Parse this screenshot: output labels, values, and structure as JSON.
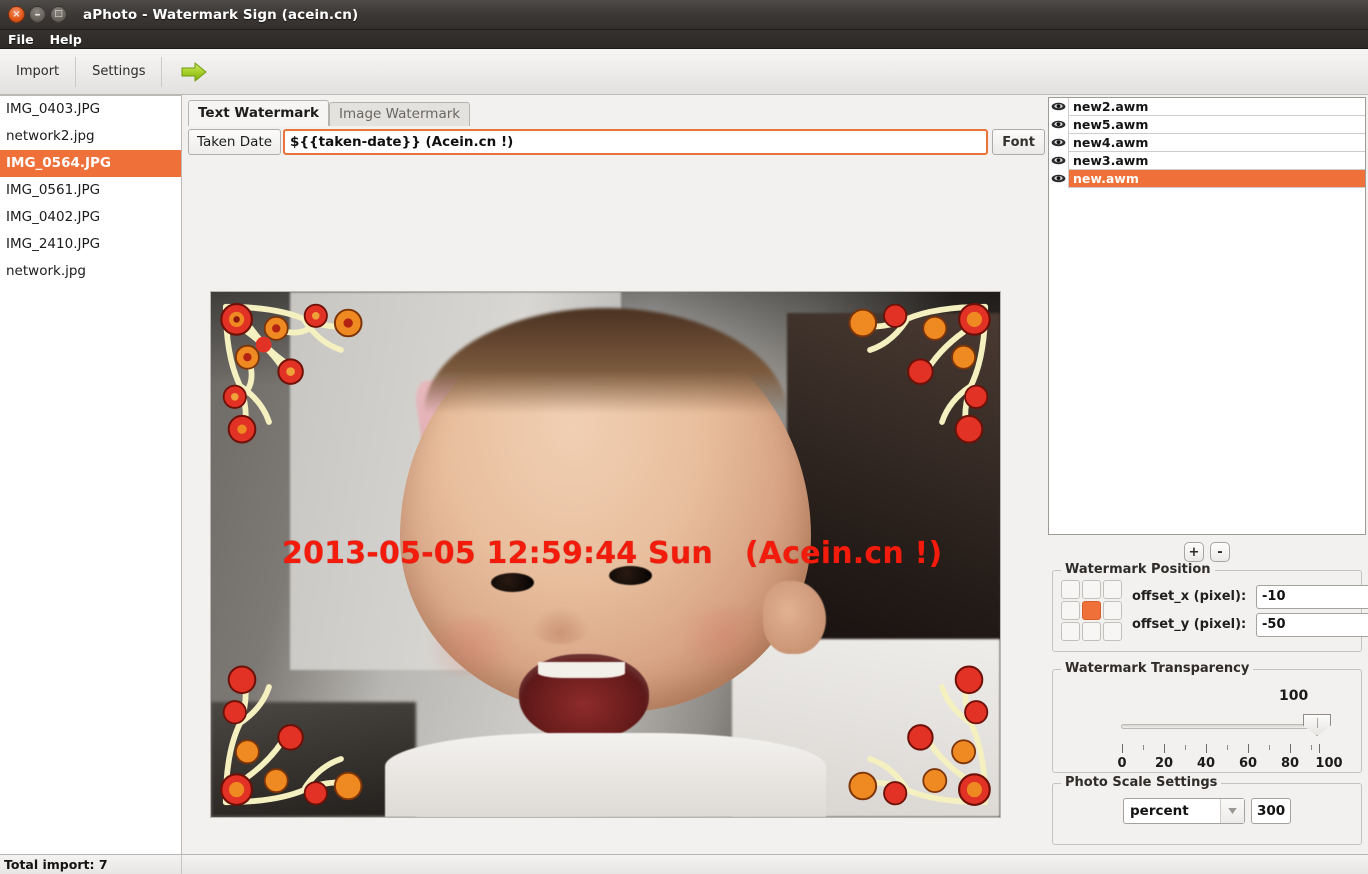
{
  "window": {
    "title": "aPhoto - Watermark Sign (acein.cn)",
    "close_icon": "close-icon",
    "minimize_icon": "minimize-icon",
    "maximize_icon": "maximize-icon",
    "close_glyph": "×",
    "minimize_glyph": "–",
    "maximize_glyph": "□"
  },
  "menu": {
    "items": [
      {
        "label": "File"
      },
      {
        "label": "Help"
      }
    ]
  },
  "toolbar": {
    "import_label": "Import",
    "settings_label": "Settings",
    "run_icon": "green-right-arrow-icon"
  },
  "filelist": {
    "items": [
      {
        "name": "IMG_0403.JPG",
        "selected": false
      },
      {
        "name": "network2.jpg",
        "selected": false
      },
      {
        "name": "IMG_0564.JPG",
        "selected": true
      },
      {
        "name": "IMG_0561.JPG",
        "selected": false
      },
      {
        "name": "IMG_0402.JPG",
        "selected": false
      },
      {
        "name": "IMG_2410.JPG",
        "selected": false
      },
      {
        "name": "network.jpg",
        "selected": false
      }
    ]
  },
  "center": {
    "tabs": [
      {
        "label": "Text Watermark",
        "active": true
      },
      {
        "label": "Image Watermark",
        "active": false
      }
    ],
    "taken_date_label": "Taken Date",
    "watermark_input_value": "${{taken-date}}  (Acein.cn !)",
    "font_button_label": "Font",
    "preview_watermark_text": "2013-05-05 12:59:44 Sun   (Acein.cn !)",
    "preview_watermark_color": "#f21b0c"
  },
  "watermark_files": {
    "items": [
      {
        "name": "new2.awm",
        "selected": false,
        "icon": "eye-icon"
      },
      {
        "name": "new5.awm",
        "selected": false,
        "icon": "eye-icon"
      },
      {
        "name": "new4.awm",
        "selected": false,
        "icon": "eye-icon"
      },
      {
        "name": "new3.awm",
        "selected": false,
        "icon": "eye-icon"
      },
      {
        "name": "new.awm",
        "selected": true,
        "icon": "eye-icon"
      }
    ],
    "add_label": "+",
    "remove_label": "-"
  },
  "position": {
    "group_title": "Watermark Position",
    "selected_cell": 4,
    "offset_x_label": "offset_x (pixel):",
    "offset_x_value": "-10",
    "offset_y_label": "offset_y (pixel):",
    "offset_y_value": "-50"
  },
  "transparency": {
    "group_title": "Watermark Transparency",
    "value": "100",
    "min": 0,
    "max": 100,
    "tick_labels": [
      "0",
      "20",
      "40",
      "60",
      "80",
      "100"
    ]
  },
  "scale": {
    "group_title": "Photo Scale Settings",
    "mode_value": "percent",
    "mode_arrow_icon": "chevron-down-icon",
    "amount_value": "300"
  },
  "statusbar": {
    "text": "Total import: 7"
  },
  "colors": {
    "selection": "#ef7039",
    "titlebar": "#3c3835",
    "panel": "#f2f1f0",
    "accent_text": "#f21b0c"
  }
}
